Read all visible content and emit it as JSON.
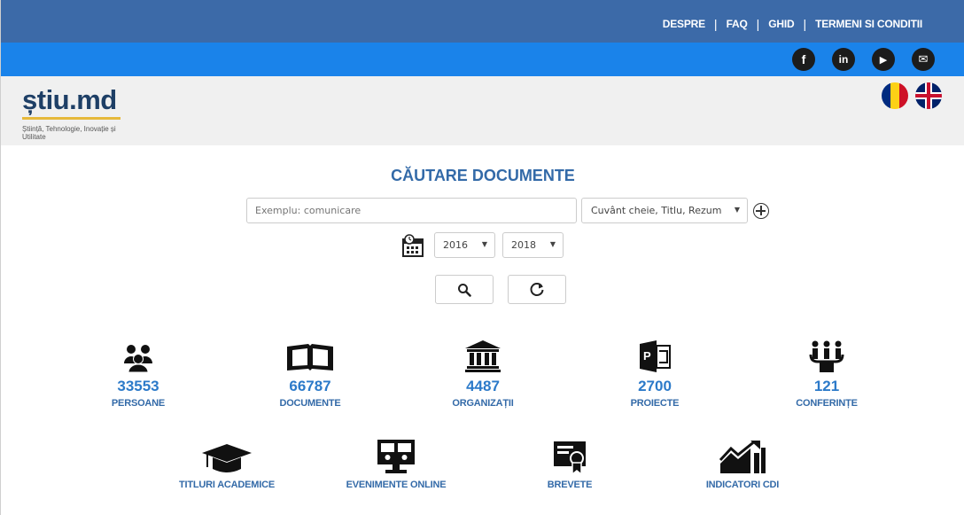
{
  "topnav": {
    "items": [
      "DESPRE",
      "FAQ",
      "GHID",
      "TERMENI SI CONDITII"
    ]
  },
  "social": [
    {
      "name": "facebook",
      "glyph": "f"
    },
    {
      "name": "linkedin",
      "glyph": "in"
    },
    {
      "name": "youtube",
      "glyph": "▶"
    },
    {
      "name": "email",
      "glyph": "✉"
    }
  ],
  "brand": {
    "logo": "știu.md",
    "tagline": "Știință, Tehnologie, Inovație și Utilitate"
  },
  "languages": [
    "ro",
    "en"
  ],
  "search": {
    "title": "CĂUTARE DOCUMENTE",
    "placeholder": "Exemplu: comunicare",
    "field": "Cuvânt cheie, Titlu, Rezum",
    "year_from": "2016",
    "year_to": "2018"
  },
  "stats": [
    {
      "icon": "users-icon",
      "count": "33553",
      "label": "PERSOANE"
    },
    {
      "icon": "book-icon",
      "count": "66787",
      "label": "DOCUMENTE"
    },
    {
      "icon": "institution-icon",
      "count": "4487",
      "label": "ORGANIZAȚII"
    },
    {
      "icon": "project-icon",
      "count": "2700",
      "label": "PROIECTE"
    },
    {
      "icon": "conference-icon",
      "count": "121",
      "label": "CONFERINȚE"
    }
  ],
  "categories": [
    {
      "icon": "graduation-cap-icon",
      "label": "TITLURI ACADEMICE"
    },
    {
      "icon": "online-event-icon",
      "label": "EVENIMENTE ONLINE"
    },
    {
      "icon": "certificate-icon",
      "label": "BREVETE"
    },
    {
      "icon": "chart-icon",
      "label": "INDICATORI CDI"
    }
  ]
}
